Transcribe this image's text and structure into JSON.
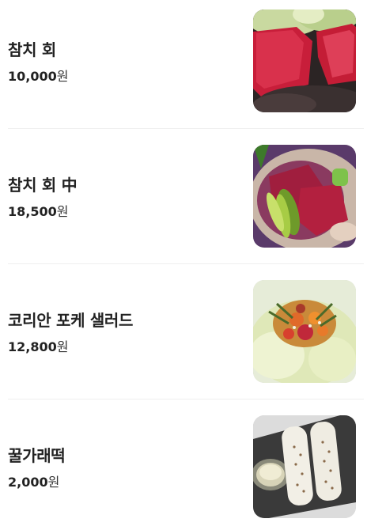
{
  "menu": {
    "items": [
      {
        "name": "참치 회",
        "price": "10,000",
        "unit": "원",
        "image": "tuna-sashimi-photo"
      },
      {
        "name": "참치 회 中",
        "price": "18,500",
        "unit": "원",
        "image": "tuna-sashimi-medium-photo"
      },
      {
        "name": "코리안 포케 샐러드",
        "price": "12,800",
        "unit": "원",
        "image": "korean-poke-salad-photo"
      },
      {
        "name": "꿀가래떡",
        "price": "2,000",
        "unit": "원",
        "image": "honey-garaetteok-photo"
      }
    ]
  }
}
